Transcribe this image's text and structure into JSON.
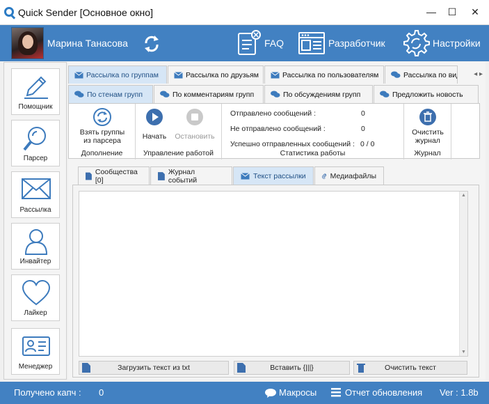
{
  "window": {
    "title": "Quick Sender [Основное окно]",
    "minimize": "—",
    "maximize": "☐",
    "close": "✕"
  },
  "header": {
    "username": "Марина Танасова",
    "faq_label": "FAQ",
    "developer_label": "Разработчик",
    "settings_label": "Настройки"
  },
  "sidebar": {
    "items": [
      {
        "label": "Помощник",
        "icon": "pen-icon"
      },
      {
        "label": "Парсер",
        "icon": "magnifier-icon"
      },
      {
        "label": "Рассылка",
        "icon": "envelope-icon"
      },
      {
        "label": "Инвайтер",
        "icon": "person-icon"
      },
      {
        "label": "Лайкер",
        "icon": "heart-icon"
      },
      {
        "label": "Менеджер",
        "icon": "id-card-icon"
      }
    ]
  },
  "tabs_main": [
    {
      "label": "Рассылка по группам",
      "active": true
    },
    {
      "label": "Рассылка по друзьям",
      "active": false
    },
    {
      "label": "Рассылка по пользователям",
      "active": false
    },
    {
      "label": "Рассылка по вид",
      "active": false
    }
  ],
  "tabs_sub": [
    {
      "label": "По стенам групп",
      "active": true
    },
    {
      "label": "По комментариям групп",
      "active": false
    },
    {
      "label": "По обсуждениям групп",
      "active": false
    },
    {
      "label": "Предложить новость",
      "active": false
    }
  ],
  "ribbon": {
    "take_groups_l1": "Взять группы",
    "take_groups_l2": "из парсера",
    "group_addition": "Дополнение",
    "start": "Начать",
    "stop": "Остановить",
    "group_control": "Управление работой",
    "sent_label": "Отправлено сообщений :",
    "sent_value": "0",
    "not_sent_label": "Не отправлено сообщений :",
    "not_sent_value": "0",
    "success_label": "Успешно отправленных сообщений :",
    "success_value": "0 / 0",
    "group_stats": "Статистика работы",
    "clear_log_l1": "Очистить",
    "clear_log_l2": "журнал",
    "group_log": "Журнал"
  },
  "content_tabs": [
    {
      "label": "Сообщества [0]",
      "active": false
    },
    {
      "label": "Журнал событий",
      "active": false
    },
    {
      "label": "Текст рассылки",
      "active": true
    },
    {
      "label": "Медиафайлы",
      "active": false
    }
  ],
  "editor": {
    "text": "",
    "load_button": "Загрузить текст из txt",
    "insert_button": "Вставить {|||}",
    "clear_button": "Очистить текст"
  },
  "statusbar": {
    "captcha_label": "Получено капч :",
    "captcha_value": "0",
    "macros_label": "Макросы",
    "changelog_label": "Отчет обновления",
    "version": "Ver : 1.8b"
  },
  "colors": {
    "accent": "#4281c2",
    "active_tab": "#d6e6f6"
  }
}
